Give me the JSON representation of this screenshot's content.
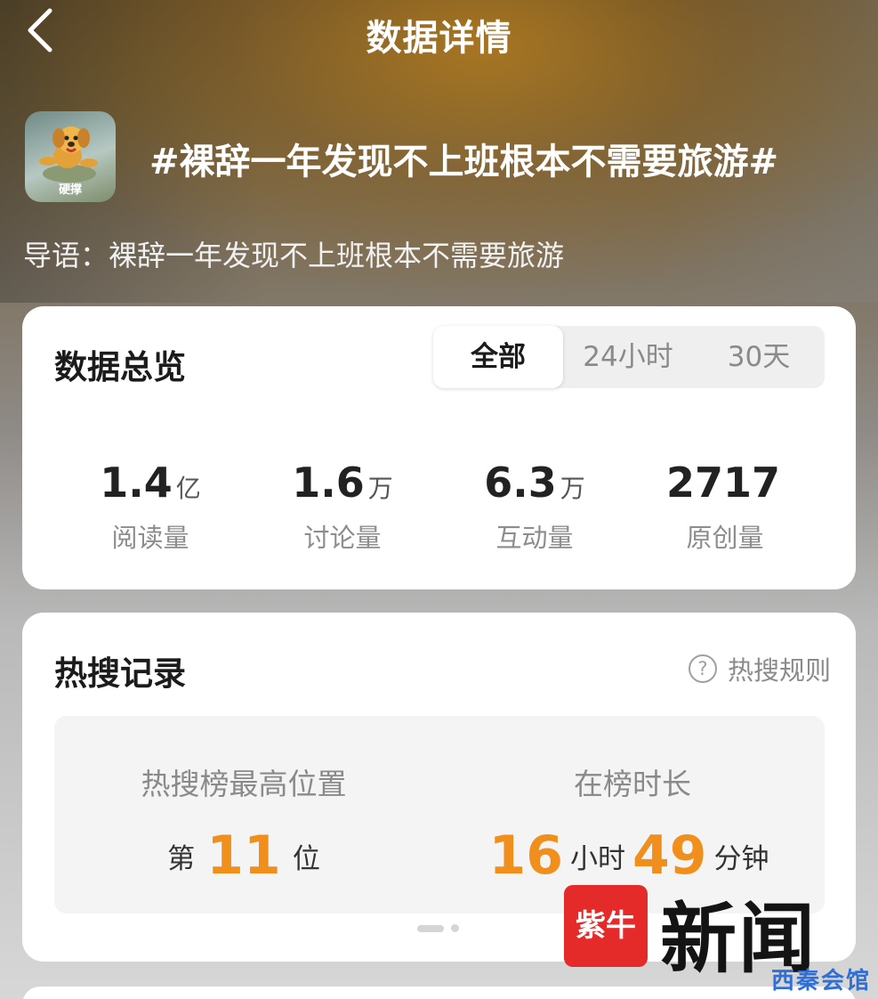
{
  "navbar": {
    "title": "数据详情"
  },
  "topic": {
    "avatar_label": "硬撑",
    "title": "#裸辞一年发现不上班根本不需要旅游#",
    "intro": "导语：裸辞一年发现不上班根本不需要旅游"
  },
  "overview": {
    "title": "数据总览",
    "tabs": [
      {
        "label": "全部",
        "active": true
      },
      {
        "label": "24小时",
        "active": false
      },
      {
        "label": "30天",
        "active": false
      }
    ],
    "stats": [
      {
        "value": "1.4",
        "unit": "亿",
        "label": "阅读量"
      },
      {
        "value": "1.6",
        "unit": "万",
        "label": "讨论量"
      },
      {
        "value": "6.3",
        "unit": "万",
        "label": "互动量"
      },
      {
        "value": "2717",
        "unit": "",
        "label": "原创量"
      }
    ]
  },
  "hot_search": {
    "title": "热搜记录",
    "rules_label": "热搜规则",
    "peak": {
      "label": "热搜榜最高位置",
      "prefix": "第",
      "rank": "11",
      "suffix": "位"
    },
    "duration": {
      "label": "在榜时长",
      "hours": "16",
      "hours_unit": "小时",
      "minutes": "49",
      "minutes_unit": "分钟"
    },
    "accent_color": "#f18f1d"
  },
  "watermark": {
    "logo_text": "紫牛",
    "brand": "新闻",
    "sub": "西秦会馆"
  }
}
